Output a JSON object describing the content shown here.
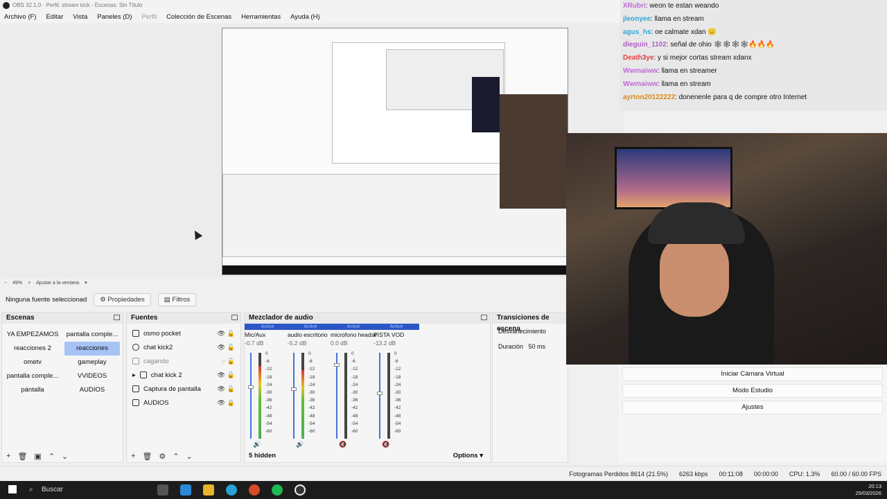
{
  "window": {
    "title": "OBS 32.1.0 - Perfil: stream kick - Escenas: Sin Título"
  },
  "menu": [
    "Archivo (F)",
    "Editar",
    "Vista",
    "Paneles (D)",
    "Perfil",
    "Colección de Escenas",
    "Herramientas",
    "Ayuda (H)"
  ],
  "zoom": {
    "level": "49%",
    "fit_label": "Ajustar a la ventana"
  },
  "source_bar": {
    "none_selected": "Ninguna fuente seleccionad",
    "properties": "Propiedades",
    "filters": "Filtros"
  },
  "scenes": {
    "title": "Escenas",
    "items": [
      "YA EMPEZAMOS",
      "pantalla comple...",
      "reacciones 2",
      "reacciones",
      "ometv",
      "gameplay",
      "pantalla comple...",
      "VVIDEOS",
      "pántalla",
      "AUDIOS"
    ],
    "selected_index": 3
  },
  "sources": {
    "title": "Fuentes",
    "items": [
      "osmo pocket",
      "chat kick2",
      "cagando",
      "chat kick 2",
      "Captura de pantalla",
      "AUDIOS"
    ]
  },
  "mixer": {
    "title": "Mezclador de audio",
    "active_label": "Active",
    "channels": [
      {
        "name": "Mic/Aux",
        "db": "-0.7 dB",
        "level": 0.85,
        "fader": 0.62
      },
      {
        "name": "audio escritorio",
        "db": "-5.2 dB",
        "level": 0.8,
        "fader": 0.6
      },
      {
        "name": "microfono headset",
        "db": "0.0 dB",
        "level": 0.0,
        "fader": 0.88
      },
      {
        "name": "PISTA VOD",
        "db": "-13.2 dB",
        "level": 0.0,
        "fader": 0.55
      }
    ],
    "ticks": [
      "0",
      "-6",
      "-12",
      "-18",
      "-24",
      "-30",
      "-36",
      "-42",
      "-48",
      "-54",
      "-60"
    ],
    "hidden": "5 hidden",
    "options": "Options"
  },
  "transitions": {
    "title": "Transiciones de escena",
    "type": "Desvanecimiento",
    "duration_label": "Duración",
    "duration_value": "50 ms"
  },
  "controls": [
    "Iniciar Cámara Virtual",
    "Modo Estudio",
    "Ajustes"
  ],
  "chat": [
    {
      "user": "XRubri",
      "msg": ": weon te estan weando",
      "color": "#c06ad8"
    },
    {
      "user": "jleonyee",
      "msg": ": llama en stream",
      "color": "#2fa7d6"
    },
    {
      "user": "agus_hs",
      "msg": ": oe calmate xdan 😑",
      "color": "#2fa7d6"
    },
    {
      "user": "dieguin_1102",
      "msg": ": señal de ohio 🕸🕸🕸🕸🔥🔥🔥",
      "color": "#b05cc6"
    },
    {
      "user": "Death3ye",
      "msg": ": y si mejor cortas stream xdanx",
      "color": "#e04040"
    },
    {
      "user": "Wwmaiww",
      "msg": ": llama en streamer",
      "color": "#c06ad8"
    },
    {
      "user": "Wwmaiww",
      "msg": ": llama en stream",
      "color": "#c06ad8"
    },
    {
      "user": "ayrton20122222",
      "msg": ": donenenle para q de compre otro Internet",
      "color": "#d88a1a"
    }
  ],
  "status": {
    "dropped": "Fotogramas Perdidos 8614 (21.5%)",
    "bitrate": "6263 kbps",
    "stream_time": "00:11:08",
    "rec_time": "00:00:00",
    "cpu": "CPU: 1.3%",
    "fps": "60.00 / 60.00 FPS"
  },
  "taskbar": {
    "search": "Buscar",
    "time": "20:13",
    "date": "25/03/2026"
  }
}
